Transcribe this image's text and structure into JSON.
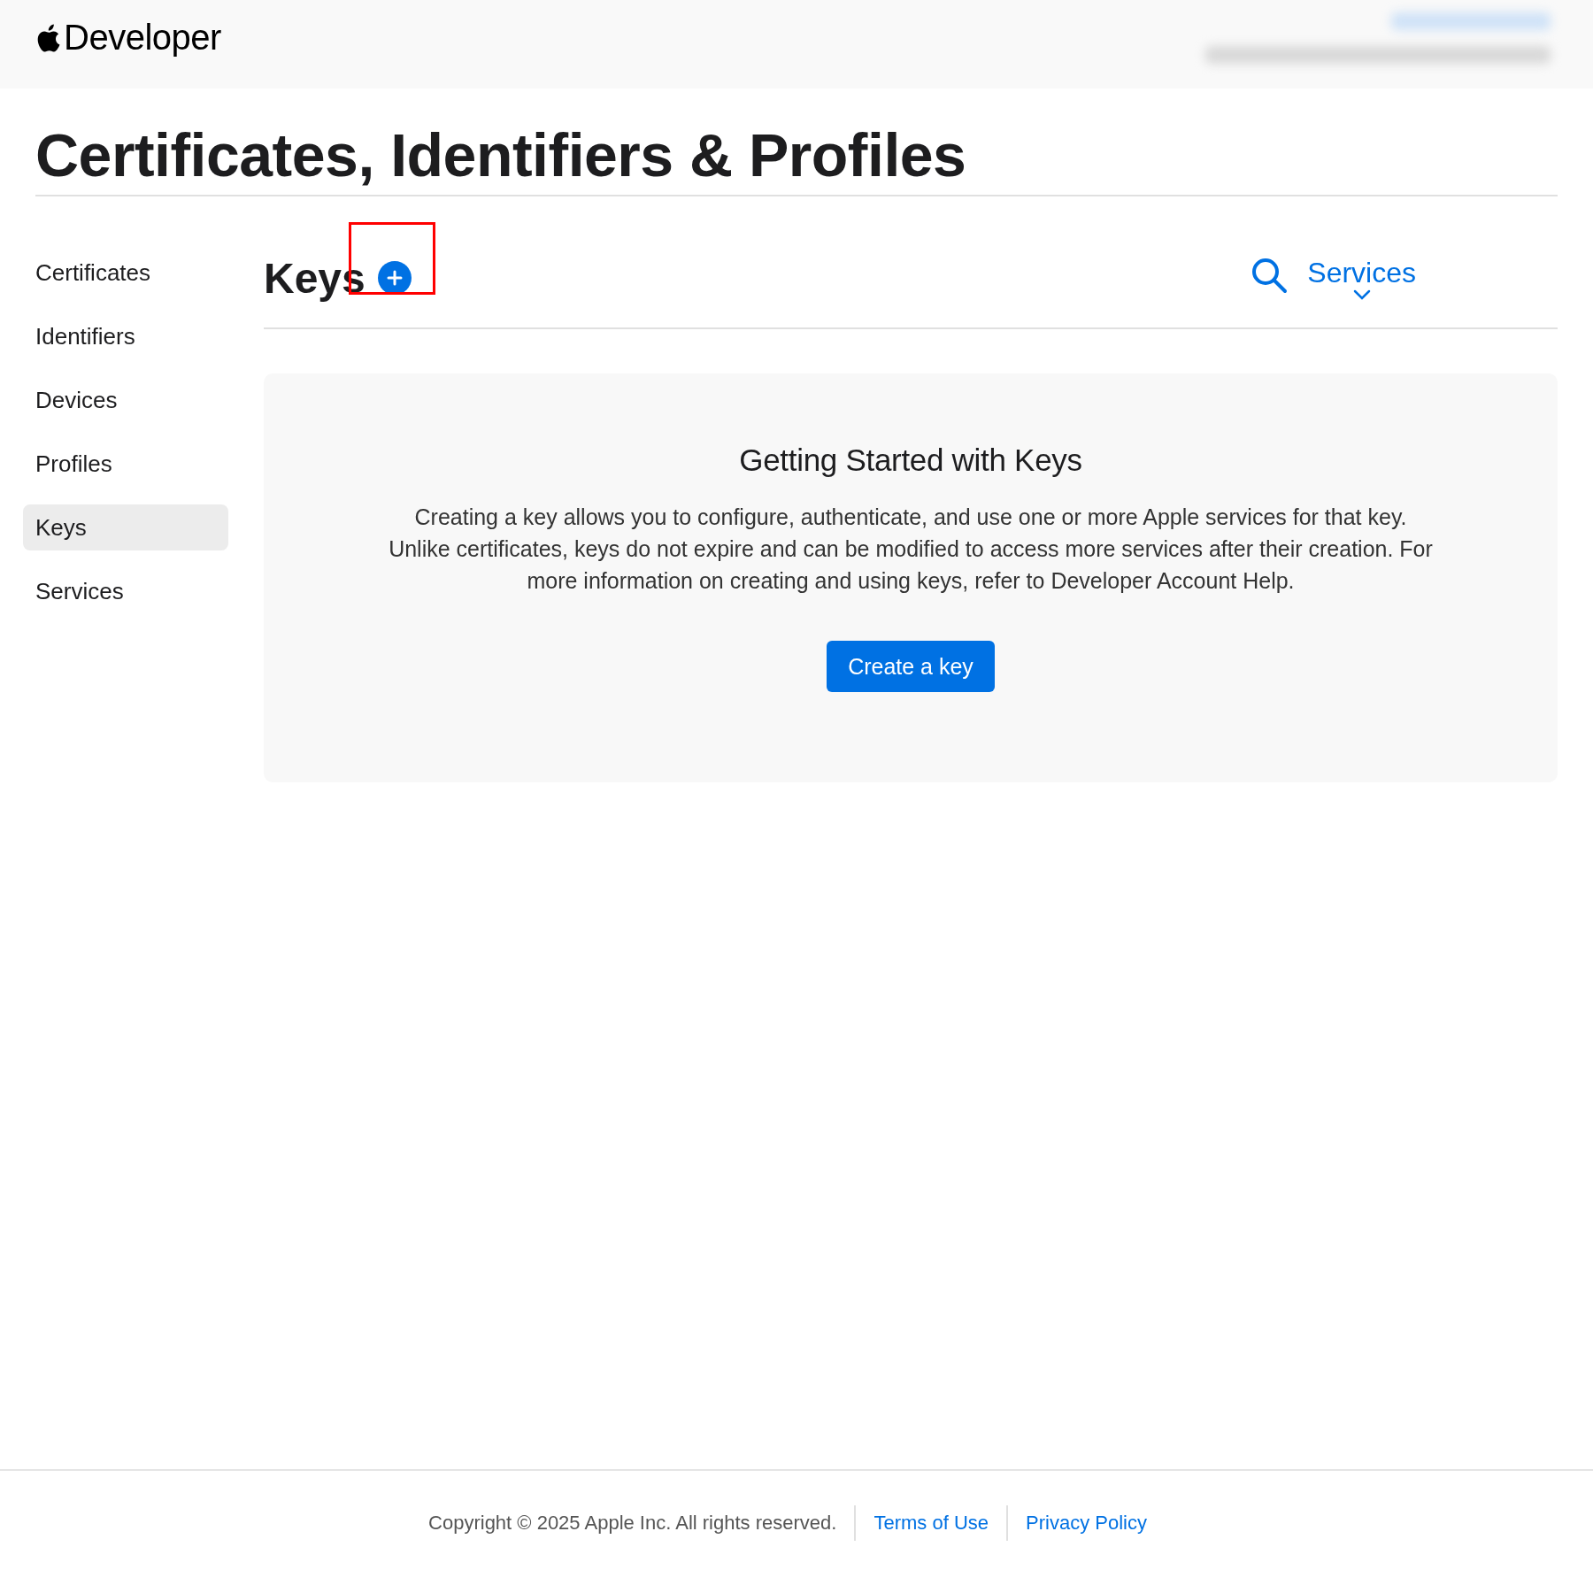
{
  "header": {
    "brand": "Developer"
  },
  "page_title": "Certificates, Identifiers & Profiles",
  "sidebar": {
    "items": [
      {
        "label": "Certificates",
        "selected": false
      },
      {
        "label": "Identifiers",
        "selected": false
      },
      {
        "label": "Devices",
        "selected": false
      },
      {
        "label": "Profiles",
        "selected": false
      },
      {
        "label": "Keys",
        "selected": true
      },
      {
        "label": "Services",
        "selected": false
      }
    ]
  },
  "section": {
    "title": "Keys",
    "filter": "Services"
  },
  "empty_state": {
    "title": "Getting Started with Keys",
    "body": "Creating a key allows you to configure, authenticate, and use one or more Apple services for that key. Unlike certificates, keys do not expire and can be modified to access more services after their creation. For more information on creating and using keys, refer to Developer Account Help.",
    "button": "Create a key"
  },
  "footer": {
    "copyright": "Copyright © 2025 Apple Inc. All rights reserved.",
    "links": [
      "Terms of Use",
      "Privacy Policy"
    ]
  }
}
